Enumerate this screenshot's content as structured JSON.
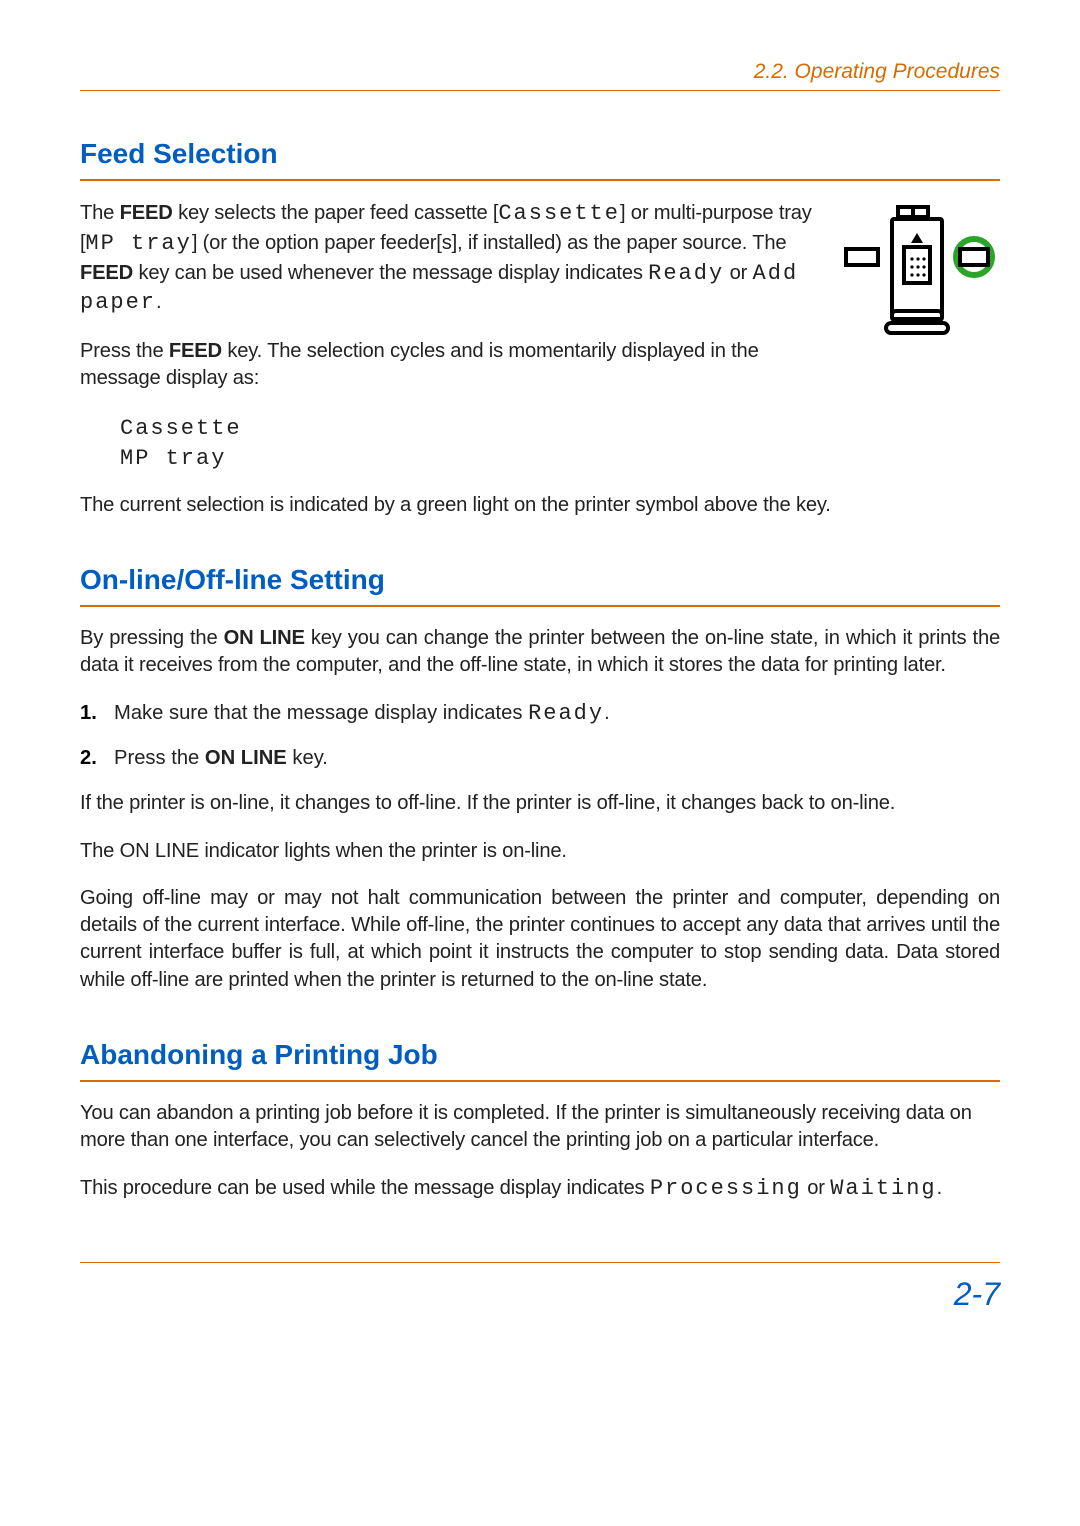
{
  "header": {
    "running_title": "2.2. Operating Procedures"
  },
  "sections": {
    "feed": {
      "title": "Feed Selection",
      "p1_a": "The ",
      "p1_key1": "FEED",
      "p1_b": " key selects the paper feed cassette [",
      "p1_lcd1": "Cassette",
      "p1_c": "] or multi-purpose tray [",
      "p1_lcd2": "MP  tray",
      "p1_d": "] (or the option paper feeder[s], if installed) as the paper source. The ",
      "p1_key2": "FEED",
      "p1_e": " key can be used whenever the message display indicates ",
      "p1_lcd3": "Ready",
      "p1_f": " or ",
      "p1_lcd4": "Add paper",
      "p1_g": ".",
      "p2_a": "Press the ",
      "p2_key": "FEED",
      "p2_b": " key. The selection cycles and is momentarily displayed in the message display as:",
      "lcd_lines": {
        "l1": "Cassette",
        "l2": "MP  tray"
      },
      "p3": "The current selection is indicated by a green light on the printer symbol above the key."
    },
    "online": {
      "title": "On-line/Off-line Setting",
      "p1_a": "By pressing the ",
      "p1_key": "ON LINE",
      "p1_b": " key you can change the printer between the on-line state, in which it prints the data it receives from the computer, and the off-line state, in which it stores the data for printing later.",
      "list": {
        "n1": "1.",
        "n2": "2.",
        "i1_a": "Make sure that the message display indicates ",
        "i1_lcd": "Ready",
        "i1_b": ".",
        "i2_a": "Press the ",
        "i2_key": "ON LINE",
        "i2_b": " key."
      },
      "p2": "If the printer is on-line, it changes to off-line. If the printer is off-line, it changes back to on-line.",
      "p3": "The ON LINE indicator lights when the printer is on-line.",
      "p4": "Going off-line may or may not halt communication between the printer and computer, depending on details of the current interface. While off-line, the printer continues to accept any data that arrives until the current interface buffer is full, at which point it instructs the computer to stop sending data. Data stored while off-line are printed when the printer is returned to the on-line state."
    },
    "abandon": {
      "title": "Abandoning a Printing Job",
      "p1": "You can abandon a printing job before it is completed. If the printer is simultaneously receiving data on more than one interface, you can selectively cancel the printing job on a particular interface.",
      "p2_a": "This procedure can be used while the message display indicates ",
      "p2_lcd1": "Processing",
      "p2_b": " or ",
      "p2_lcd2": "Waiting",
      "p2_c": "."
    }
  },
  "page_number": "2-7"
}
